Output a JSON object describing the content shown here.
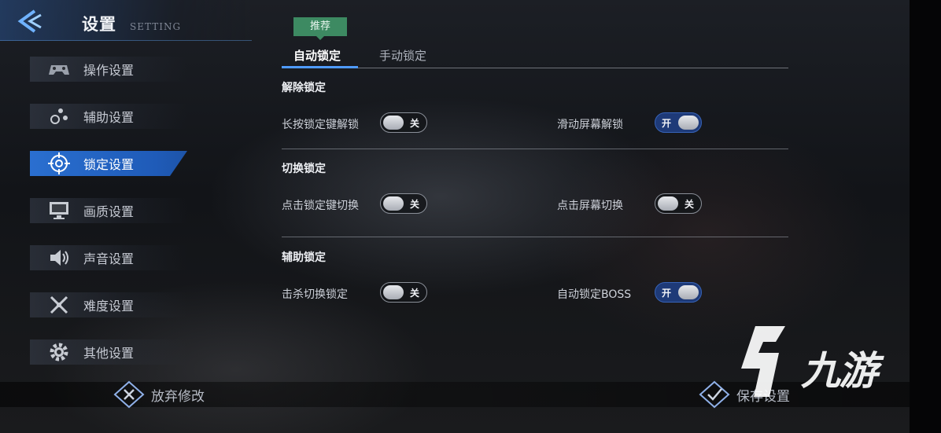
{
  "header": {
    "title": "设置",
    "subtitle": "SETTING"
  },
  "sidebar": {
    "items": [
      {
        "label": "操作设置",
        "icon": "gamepad-icon"
      },
      {
        "label": "辅助设置",
        "icon": "dots-icon"
      },
      {
        "label": "锁定设置",
        "icon": "crosshair-icon",
        "active": true
      },
      {
        "label": "画质设置",
        "icon": "monitor-icon"
      },
      {
        "label": "声音设置",
        "icon": "speaker-icon"
      },
      {
        "label": "难度设置",
        "icon": "crossed-swords-icon"
      },
      {
        "label": "其他设置",
        "icon": "gear-icon"
      }
    ]
  },
  "tabs": {
    "badge": "推荐",
    "items": [
      {
        "label": "自动锁定",
        "active": true
      },
      {
        "label": "手动锁定"
      }
    ]
  },
  "sections": [
    {
      "title": "解除锁定",
      "options": [
        {
          "label": "长按锁定键解锁",
          "state": "关",
          "on": false
        },
        {
          "label": "滑动屏幕解锁",
          "state": "开",
          "on": true
        }
      ]
    },
    {
      "title": "切换锁定",
      "options": [
        {
          "label": "点击锁定键切换",
          "state": "关",
          "on": false
        },
        {
          "label": "点击屏幕切换",
          "state": "关",
          "on": false
        }
      ]
    },
    {
      "title": "辅助锁定",
      "options": [
        {
          "label": "击杀切换锁定",
          "state": "关",
          "on": false
        },
        {
          "label": "自动锁定BOSS",
          "state": "开",
          "on": true
        }
      ]
    }
  ],
  "bottom": {
    "discard": "放弃修改",
    "save": "保存设置"
  },
  "watermark": {
    "text": "九游",
    "logo": "jiuyou-logo-icon"
  },
  "colors": {
    "accent": "#2a6fd0",
    "badge": "#3d8a62",
    "toggle_on": "#1e3a78"
  }
}
